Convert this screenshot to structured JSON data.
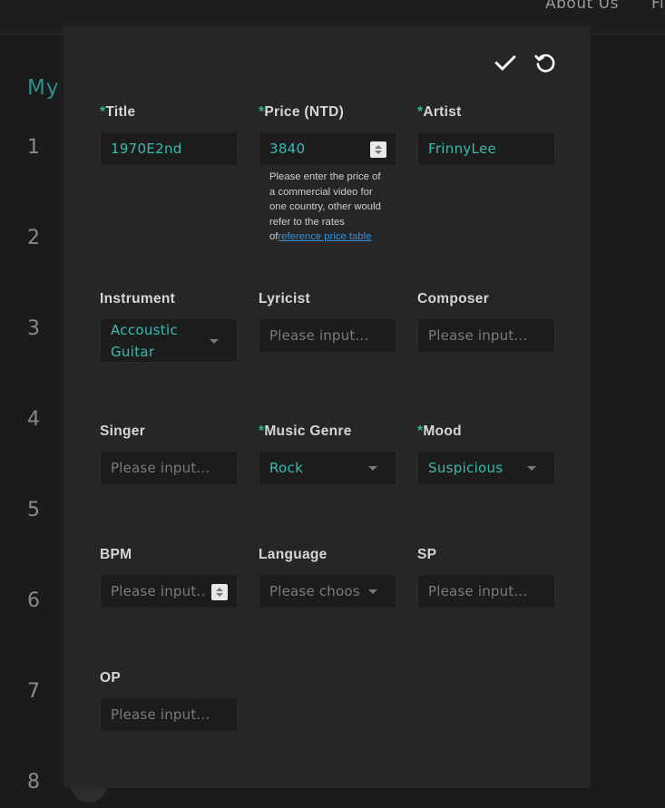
{
  "background": {
    "nav": [
      "About Us",
      "Fi"
    ],
    "heading": "My",
    "row_numbers": [
      "1",
      "2",
      "3",
      "4",
      "5",
      "6",
      "7",
      "8"
    ]
  },
  "colors": {
    "accent": "#36bdb0",
    "required_mark": "#2cb3a5",
    "link": "#3a8fd6"
  },
  "actions": {
    "confirm_icon": "check-icon",
    "reset_icon": "refresh-icon"
  },
  "fields": {
    "title": {
      "req": "*",
      "label": "Title",
      "value": "1970E2nd"
    },
    "price": {
      "req": "*",
      "label": "Price (NTD)",
      "value": "3840",
      "hint": "Please enter the price of a commercial video for one country, other would refer to the rates of",
      "hint_link": "reference price table"
    },
    "artist": {
      "req": "*",
      "label": "Artist",
      "value": "FrinnyLee"
    },
    "instrument": {
      "label": "Instrument",
      "value": "Accoustic Guitar"
    },
    "lyricist": {
      "label": "Lyricist",
      "placeholder": "Please input..."
    },
    "composer": {
      "label": "Composer",
      "placeholder": "Please input..."
    },
    "singer": {
      "label": "Singer",
      "placeholder": "Please input..."
    },
    "genre": {
      "req": "*",
      "label": "Music Genre",
      "value": "Rock"
    },
    "mood": {
      "req": "*",
      "label": "Mood",
      "value": "Suspicious"
    },
    "bpm": {
      "label": "BPM",
      "placeholder": "Please input..."
    },
    "language": {
      "label": "Language",
      "placeholder": "Please choose"
    },
    "sp": {
      "label": "SP",
      "placeholder": "Please input..."
    },
    "op": {
      "label": "OP",
      "placeholder": "Please input..."
    }
  }
}
